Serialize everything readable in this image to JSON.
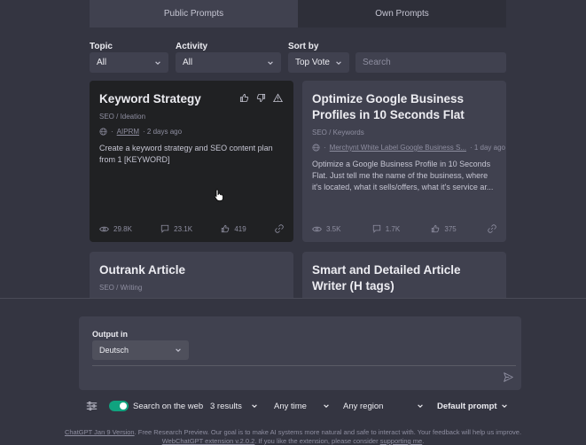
{
  "tabs": [
    {
      "label": "Public Prompts",
      "active": true
    },
    {
      "label": "Own Prompts",
      "active": false
    }
  ],
  "filters": {
    "topic": {
      "label": "Topic",
      "value": "All"
    },
    "activity": {
      "label": "Activity",
      "value": "All"
    },
    "sort": {
      "label": "Sort by",
      "value": "Top Vote"
    },
    "search": {
      "placeholder": "Search"
    }
  },
  "cards": [
    {
      "title": "Keyword Strategy",
      "category": "SEO / Ideation",
      "author": "AIPRM",
      "time": "· 2 days ago",
      "description": "Create a keyword strategy and SEO content plan from 1 [KEYWORD]",
      "views": "29.8K",
      "comments": "23.1K",
      "likes": "419"
    },
    {
      "title": "Optimize Google Business Profiles in 10 Seconds Flat",
      "category": "SEO / Keywords",
      "author": "Merchynt White Label Google Business S...",
      "time": "· 1 day ago",
      "description": "Optimize a Google Business Profile in 10 Seconds Flat. Just tell me the name of the business, where it's located, what it sells/offers, what it's service ar...",
      "views": "3.5K",
      "comments": "1.7K",
      "likes": "375"
    },
    {
      "title": "Outrank Article",
      "category": "SEO / Writing"
    },
    {
      "title": "Smart and Detailed Article Writer (H tags)"
    }
  ],
  "output": {
    "label": "Output in",
    "language": "Deutsch"
  },
  "toolbar": {
    "search_web_label": "Search on the web",
    "results": "3 results",
    "time": "Any time",
    "region": "Any region",
    "prompt": "Default prompt"
  },
  "footer": {
    "line1_link": "ChatGPT Jan 9 Version",
    "line1_text": ". Free Research Preview. Our goal is to make AI systems more natural and safe to interact with. Your feedback will help us improve.",
    "line2_link": "WebChatGPT extension v.2.0.2",
    "line2_text": ". If you like the extension, please consider ",
    "line2_link2": "supporting me",
    "line2_end": "."
  },
  "colors": {
    "background": "#343541",
    "card": "#40414f",
    "card_hover": "#202123",
    "toggle_on": "#10a37f"
  }
}
